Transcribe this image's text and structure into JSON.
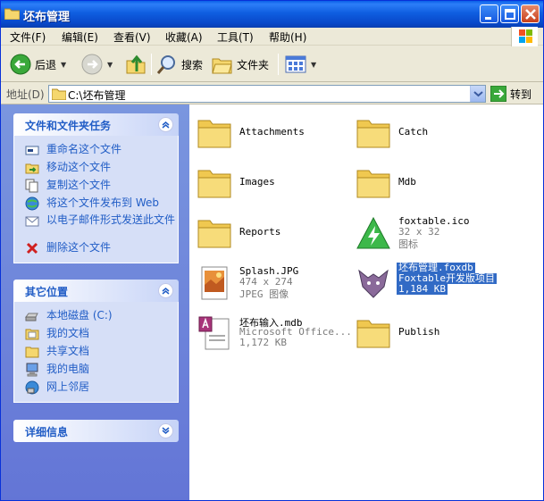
{
  "window": {
    "title": "坯布管理"
  },
  "menu": {
    "items": [
      "文件(F)",
      "编辑(E)",
      "查看(V)",
      "收藏(A)",
      "工具(T)",
      "帮助(H)"
    ]
  },
  "toolbar": {
    "back_label": "后退",
    "search_label": "搜索",
    "folders_label": "文件夹"
  },
  "address": {
    "label": "地址(D)",
    "path": "C:\\坯布管理",
    "go_label": "转到"
  },
  "tasks_panel": {
    "title": "文件和文件夹任务",
    "items": [
      {
        "label": "重命名这个文件",
        "icon": "rename-icon"
      },
      {
        "label": "移动这个文件",
        "icon": "move-icon"
      },
      {
        "label": "复制这个文件",
        "icon": "copy-icon"
      },
      {
        "label": "将这个文件发布到 Web",
        "icon": "publish-web-icon"
      },
      {
        "label": "以电子邮件形式发送此文件",
        "icon": "email-icon"
      },
      {
        "label": "删除这个文件",
        "icon": "delete-icon"
      }
    ]
  },
  "places_panel": {
    "title": "其它位置",
    "items": [
      {
        "label": "本地磁盘 (C:)",
        "icon": "local-disk-icon"
      },
      {
        "label": "我的文档",
        "icon": "my-documents-icon"
      },
      {
        "label": "共享文档",
        "icon": "shared-documents-icon"
      },
      {
        "label": "我的电脑",
        "icon": "my-computer-icon"
      },
      {
        "label": "网上邻居",
        "icon": "network-places-icon"
      }
    ]
  },
  "details_panel": {
    "title": "详细信息"
  },
  "files": [
    {
      "name": "Attachments",
      "type": "folder"
    },
    {
      "name": "Catch",
      "type": "folder"
    },
    {
      "name": "Images",
      "type": "folder"
    },
    {
      "name": "Mdb",
      "type": "folder"
    },
    {
      "name": "Reports",
      "type": "folder"
    },
    {
      "name": "foxtable.ico",
      "line2": "32 x 32",
      "line3": "图标",
      "type": "icon-file"
    },
    {
      "name": "Splash.JPG",
      "line2": "474 x 274",
      "line3": "JPEG 图像",
      "type": "image-file"
    },
    {
      "name": "坯布管理.foxdb",
      "line2": "Foxtable开发版项目",
      "line3": "1,184 KB",
      "type": "foxdb-file",
      "selected": true
    },
    {
      "name": "坯布输入.mdb",
      "line2": "Microsoft Office...",
      "line3": "1,172 KB",
      "type": "access-file"
    },
    {
      "name": "Publish",
      "type": "folder"
    }
  ],
  "colors": {
    "titlebar": "#0a5fe8",
    "sidebar": "#6f86da",
    "task_link": "#215dc6",
    "selection": "#316ac5"
  }
}
